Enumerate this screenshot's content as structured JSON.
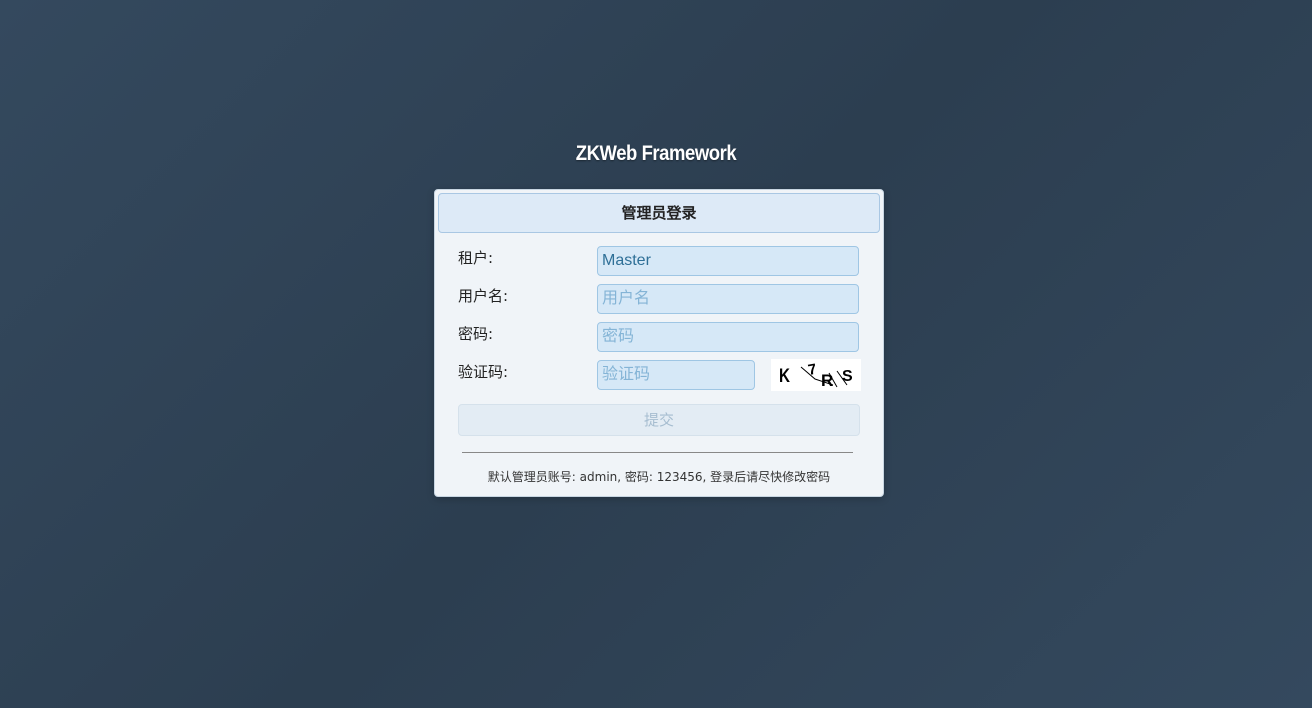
{
  "app": {
    "title": "ZKWeb Framework"
  },
  "login": {
    "header": "管理员登录",
    "fields": {
      "tenant": {
        "label": "租户:",
        "value": "Master",
        "placeholder": ""
      },
      "username": {
        "label": "用户名:",
        "value": "",
        "placeholder": "用户名"
      },
      "password": {
        "label": "密码:",
        "value": "",
        "placeholder": "密码"
      },
      "captcha": {
        "label": "验证码:",
        "value": "",
        "placeholder": "验证码"
      }
    },
    "captcha_image": {
      "text": "K7RS",
      "icon": "captcha-image"
    },
    "submit_label": "提交",
    "hint": "默认管理员账号: admin, 密码: 123456, 登录后请尽快修改密码"
  },
  "colors": {
    "background": "#2c3e50",
    "panel": "#f0f4f8",
    "header_bg": "#ddeaf7",
    "input_bg": "#d6e8f7",
    "input_text": "#2e6f97"
  }
}
